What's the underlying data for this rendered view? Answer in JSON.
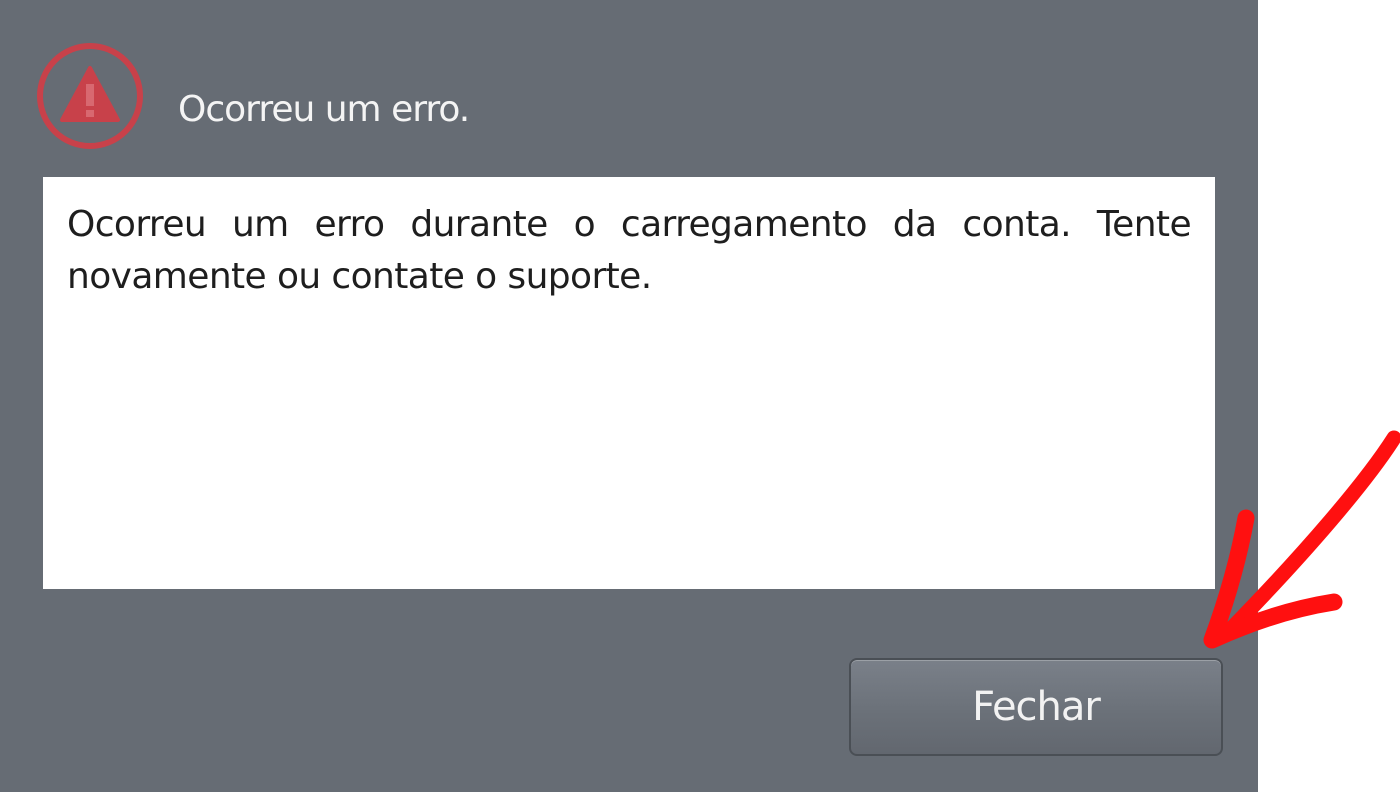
{
  "dialog": {
    "title": "Ocorreu um erro.",
    "icon": "warning-icon",
    "message": "Ocorreu um erro durante o carregamento da conta. Tente novamente ou contate o suporte.",
    "close_label": "Fechar"
  },
  "colors": {
    "dialog_background": "#666c74",
    "warning_red": "#c8414a",
    "annotation_arrow": "#ff1010"
  },
  "annotation": {
    "icon": "red-arrow-icon",
    "points_to": "close-button"
  }
}
